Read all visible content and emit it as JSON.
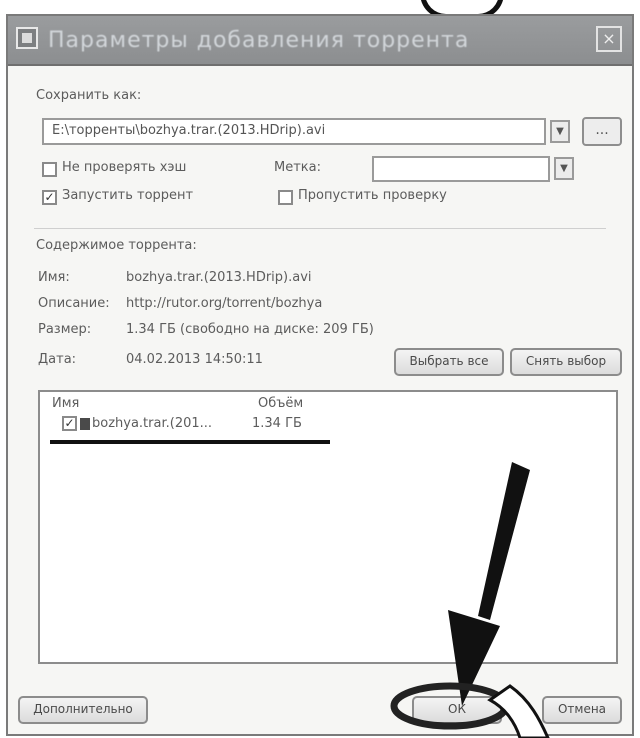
{
  "dialog": {
    "title": "Параметры добавления торрента",
    "close_glyph": "×",
    "save_as_label": "Сохранить как:",
    "save_path": "E:\\торренты\\bozhya.trar.(2013.HDrip).avi",
    "browse_label": "...",
    "dont_check_label": "Не проверять хэш",
    "start_torrent_label": "Запустить торрент",
    "label_field_label": "Метка:",
    "label_value": "",
    "skip_check_label": "Пропустить проверку",
    "torrent_content_label": "Содержимое торрента:",
    "info": [
      {
        "key": "Имя:",
        "value": "bozhya.trar.(2013.HDrip).avi"
      },
      {
        "key": "Описание:",
        "value": "http://rutor.org/torrent/bozhya"
      },
      {
        "key": "Размер:",
        "value": "1.34 ГБ (свободно на диске: 209 ГБ)"
      },
      {
        "key": "Дата:",
        "value": "04.02.2013 14:50:11"
      }
    ],
    "select_all_label": "Выбрать все",
    "select_none_label": "Снять выбор",
    "files_header": {
      "name": "Имя",
      "size": "Объём"
    },
    "file_row": {
      "name": "bozhya.trar.(201...",
      "size": "1.34 ГБ",
      "checked": true
    },
    "advanced_label": "Дополнительно",
    "ok_label": "ОК",
    "cancel_label": "Отмена"
  }
}
